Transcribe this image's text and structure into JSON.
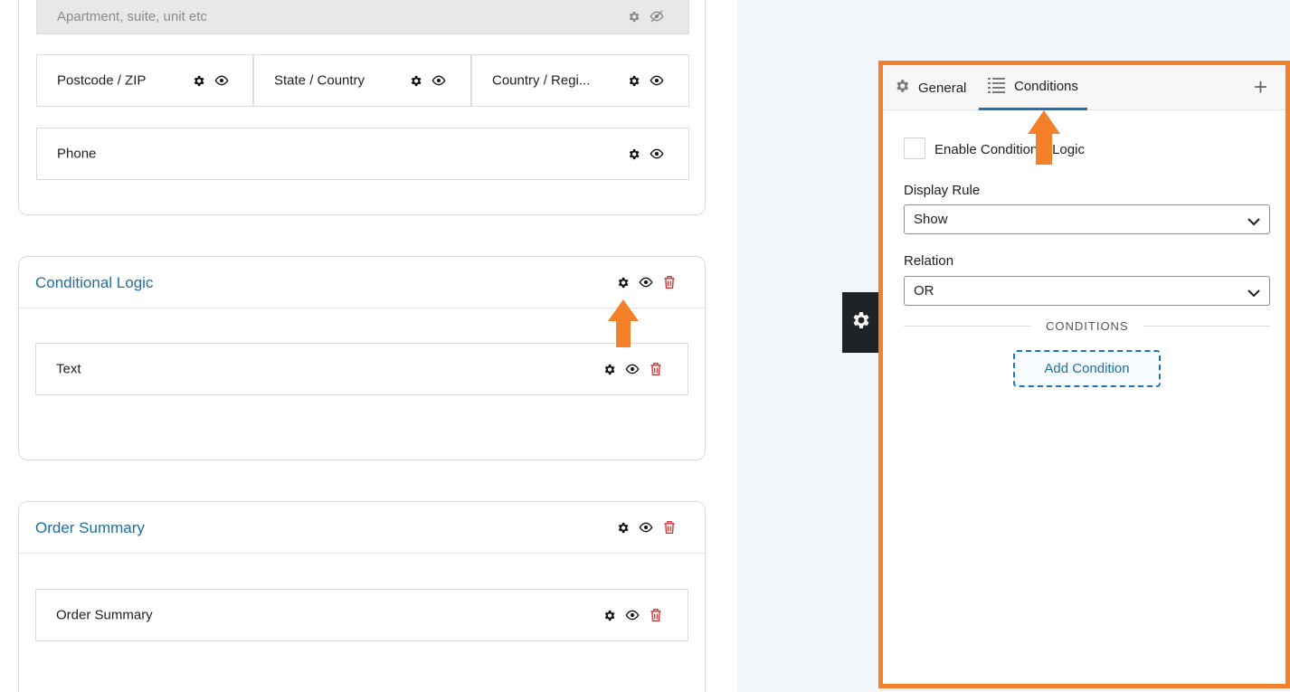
{
  "left": {
    "address_line2_placeholder": "Apartment, suite, unit etc",
    "address_fields": [
      {
        "label": "Postcode / ZIP"
      },
      {
        "label": "State / Country"
      },
      {
        "label": "Country / Regi..."
      }
    ],
    "phone_label": "Phone",
    "sections": [
      {
        "title": "Conditional Logic",
        "field_label": "Text"
      },
      {
        "title": "Order Summary",
        "field_label": "Order Summary"
      }
    ]
  },
  "panel": {
    "tabs": [
      {
        "label": "General",
        "icon": "gear-icon"
      },
      {
        "label": "Conditions",
        "icon": "list-icon",
        "active": true
      }
    ],
    "add_icon": "+",
    "enable_label": "Enable Conditional Logic",
    "display_rule": {
      "label": "Display Rule",
      "value": "Show"
    },
    "relation": {
      "label": "Relation",
      "value": "OR"
    },
    "conditions_heading": "CONDITIONS",
    "add_condition_label": "Add Condition"
  },
  "colors": {
    "accent_orange": "#f5802a",
    "link_blue": "#1e6ea1",
    "tab_underline": "#2271b1",
    "delete_red": "#d63638",
    "toggle_dark": "#1d2327"
  }
}
